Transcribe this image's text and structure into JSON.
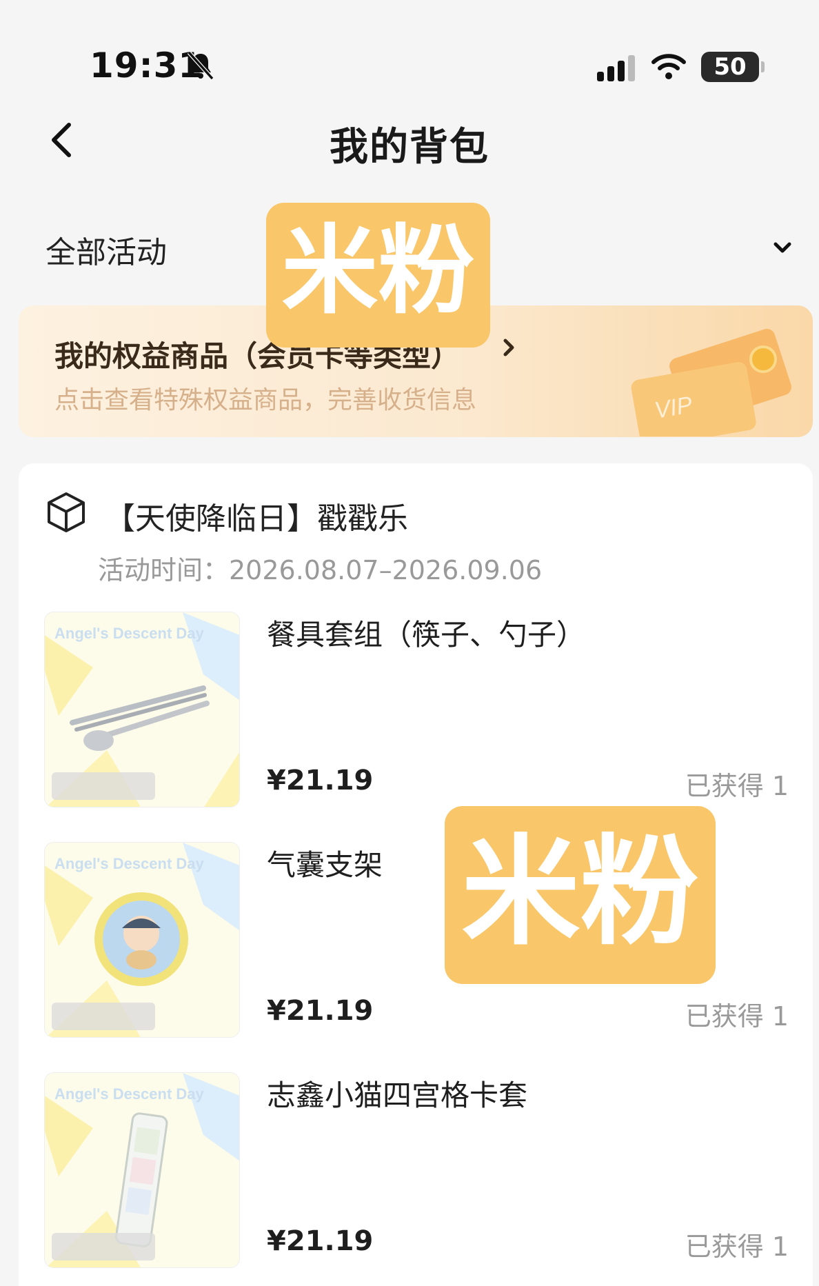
{
  "status_bar": {
    "time": "19:31",
    "battery": "50"
  },
  "nav": {
    "title": "我的背包"
  },
  "filter": {
    "label": "全部活动"
  },
  "benefit": {
    "title": "我的权益商品（会员卡等类型）",
    "subtitle": "点击查看特殊权益商品，完善收货信息",
    "vip_text": "VIP"
  },
  "watermarks": [
    "米粉",
    "米粉"
  ],
  "activity": {
    "title": "【天使降临日】戳戳乐",
    "time": "活动时间：2026.08.07–2026.09.06",
    "image_brand": "Angel's Descent Day",
    "items": [
      {
        "name": "餐具套组（筷子、勺子）",
        "price": "¥21.19",
        "count": "已获得 1"
      },
      {
        "name": "气囊支架",
        "price": "¥21.19",
        "count": "已获得 1"
      },
      {
        "name": "志鑫小猫四宫格卡套",
        "price": "¥21.19",
        "count": "已获得 1"
      }
    ]
  },
  "colors": {
    "accent": "#f9c66a",
    "banner_start": "#fdf1e0",
    "banner_end": "#fad8a8",
    "muted": "#999999"
  }
}
